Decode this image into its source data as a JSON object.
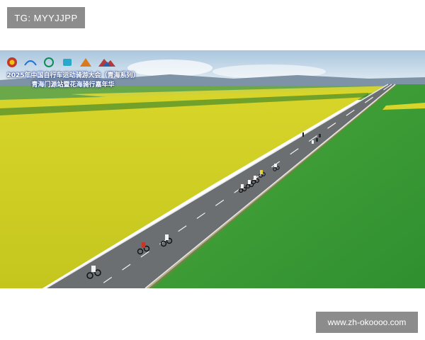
{
  "watermarks": {
    "top_label": "TG: MYYJJPP",
    "bottom_label": "www.zh-okoooo.com"
  },
  "photo": {
    "event_title_line1": "2025年中国自行车运动骑游大会（青海系列）",
    "event_title_line2": "青海门源站暨花海骑行嘉年华",
    "sponsor_logos": [
      "emblem-logo",
      "sponsor-logo-2",
      "sponsor-logo-3",
      "sponsor-logo-4",
      "sponsor-logo-5",
      "mountain-logo"
    ],
    "colors": {
      "sky": "#c9dbe8",
      "rapeseed_field": "#e4e02a",
      "green_field": "#3ea43a",
      "road": "#6b6f72"
    }
  }
}
